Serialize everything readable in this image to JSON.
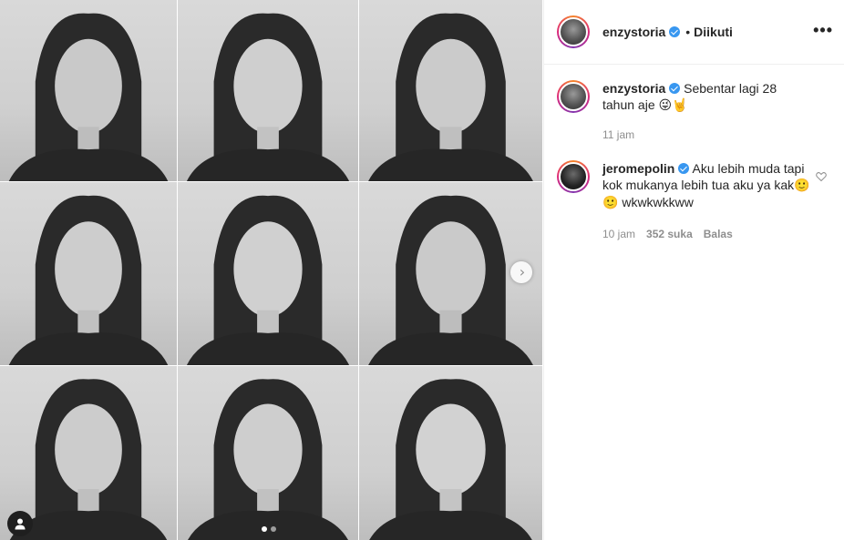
{
  "post": {
    "username": "enzystoria",
    "separator": "•",
    "follow_status": "Diikuti",
    "more_icon": "•••"
  },
  "caption": {
    "username": "enzystoria",
    "text": "Sebentar lagi 28 tahun aje",
    "emoji": "😜🤘",
    "time": "11 jam"
  },
  "comments": [
    {
      "username": "jeromepolin",
      "text": "Aku lebih muda tapi kok mukanya lebih tua aku ya kak",
      "emoji": "🙂🙂",
      "text_suffix": "wkwkwkkww",
      "time": "10 jam",
      "likes": "352 suka",
      "reply": "Balas"
    }
  ],
  "carousel": {
    "next_icon": "›",
    "current_slide": 1,
    "slide_count": 2
  },
  "colors": {
    "verified": "#3897f0",
    "text": "#262626",
    "muted": "#8e8e8e"
  }
}
